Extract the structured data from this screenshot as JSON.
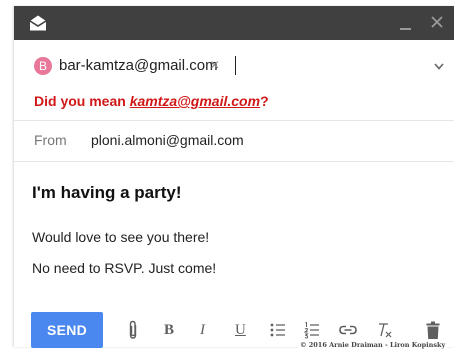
{
  "to_field": {
    "chip_initial": "B",
    "chip_email": "bar-kamtza@gmail.com",
    "chip_remove": "×"
  },
  "suggestion": {
    "prefix": "Did you mean ",
    "link": "kamtza@gmail.com",
    "suffix": "?"
  },
  "from_field": {
    "label": "From",
    "value": "ploni.almoni@gmail.com"
  },
  "message": {
    "subject": "I'm having a party!",
    "body_lines": [
      "Would love to see you there!",
      "No need to RSVP. Just come!"
    ]
  },
  "toolbar": {
    "send_label": "SEND",
    "bold_label": "B",
    "italic_label": "I",
    "underline_label": "U"
  },
  "credit": "© 2016 Arnie Draiman - Liron Kopinsky",
  "icons": {
    "app": "mail-icon",
    "minimize": "minimize-icon",
    "close": "close-icon",
    "expand": "chevron-down-icon",
    "attach": "paperclip-icon",
    "bullets": "bulleted-list-icon",
    "numbers": "numbered-list-icon",
    "link": "link-icon",
    "clear_format": "clear-formatting-icon",
    "delete": "trash-icon"
  },
  "colors": {
    "titlebar": "#404040",
    "avatar": "#e8779a",
    "suggestion": "#d01818",
    "send": "#4a88f0"
  }
}
